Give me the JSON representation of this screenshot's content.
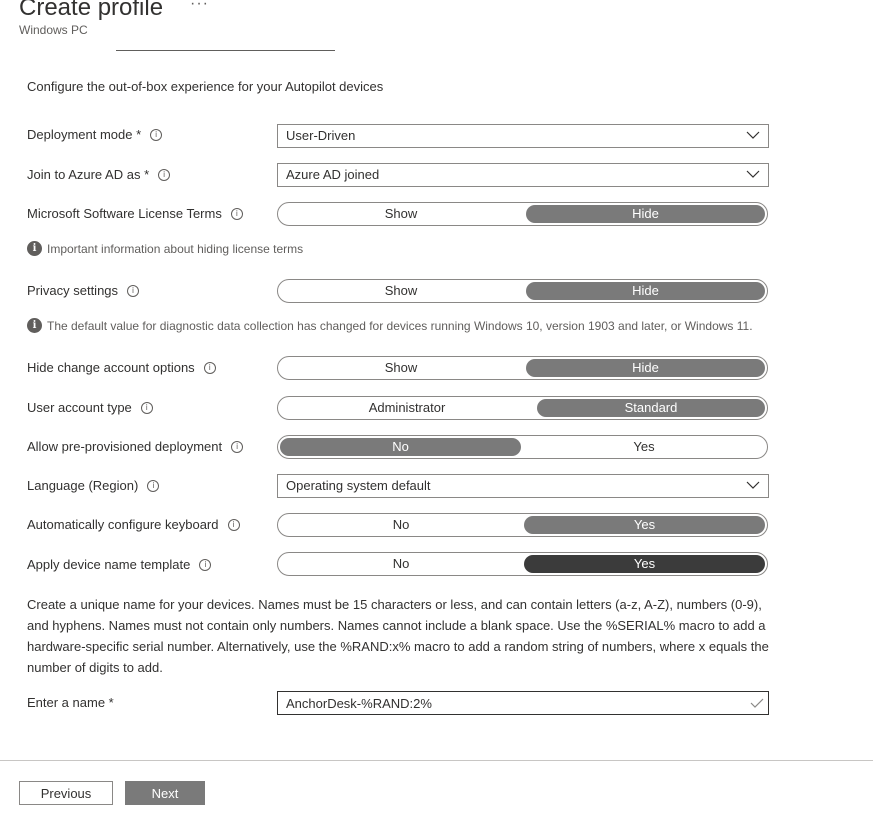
{
  "header": {
    "title": "Create profile",
    "more": "···",
    "subtitle": "Windows PC"
  },
  "intro": "Configure the out-of-box experience for your Autopilot devices",
  "rows": {
    "deployment_mode": {
      "label": "Deployment mode *",
      "value": "User-Driven"
    },
    "join_azure": {
      "label": "Join to Azure AD as *",
      "value": "Azure AD joined"
    },
    "license_terms": {
      "label": "Microsoft Software License Terms",
      "options": [
        "Show",
        "Hide"
      ],
      "selected": "Hide"
    },
    "license_notice": "Important information about hiding license terms",
    "privacy": {
      "label": "Privacy settings",
      "options": [
        "Show",
        "Hide"
      ],
      "selected": "Hide"
    },
    "privacy_notice": "The default value for diagnostic data collection has changed for devices running Windows 10, version 1903 and later, or Windows 11.",
    "change_account": {
      "label": "Hide change account options",
      "options": [
        "Show",
        "Hide"
      ],
      "selected": "Hide"
    },
    "account_type": {
      "label": "User account type",
      "options": [
        "Administrator",
        "Standard"
      ],
      "selected": "Standard"
    },
    "preprovisioned": {
      "label": "Allow pre-provisioned deployment",
      "options": [
        "No",
        "Yes"
      ],
      "selected": "No"
    },
    "language": {
      "label": "Language (Region)",
      "value": "Operating system default"
    },
    "keyboard": {
      "label": "Automatically configure keyboard",
      "options": [
        "No",
        "Yes"
      ],
      "selected": "Yes"
    },
    "name_template": {
      "label": "Apply device name template",
      "options": [
        "No",
        "Yes"
      ],
      "selected": "Yes"
    }
  },
  "description": "Create a unique name for your devices. Names must be 15 characters or less, and can contain letters (a-z, A-Z), numbers (0-9), and hyphens. Names must not contain only numbers. Names cannot include a blank space. Use the %SERIAL% macro to add a hardware-specific serial number. Alternatively, use the %RAND:x% macro to add a random string of numbers, where x equals the number of digits to add.",
  "name_field": {
    "label": "Enter a name *",
    "value": "AnchorDesk-%RAND:2%"
  },
  "footer": {
    "previous": "Previous",
    "next": "Next"
  },
  "colors": {
    "selected": "#7a7a7a",
    "selected_focus": "#3b3b3b",
    "text": "#323130",
    "border": "#8a8886"
  },
  "icons": {
    "info": "info-icon",
    "notice": "info-filled-icon",
    "dropdown": "chevron-down-icon",
    "valid": "checkmark-icon"
  }
}
